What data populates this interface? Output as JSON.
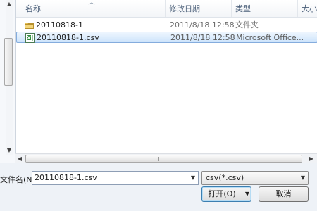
{
  "columns": {
    "name": "名称",
    "date": "修改日期",
    "type": "类型",
    "size": "大小"
  },
  "files": [
    {
      "name": "20110818-1",
      "date": "2011/8/18 12:58",
      "type": "文件夹",
      "icon": "folder-icon",
      "selected": false
    },
    {
      "name": "20110818-1.csv",
      "date": "2011/8/18 12:58",
      "type": "Microsoft Office...",
      "icon": "excel-csv-icon",
      "selected": true
    }
  ],
  "filename": {
    "label": "文件名(N):",
    "value": "20110818-1.csv"
  },
  "filetype": {
    "selected": "csv(*.csv)"
  },
  "buttons": {
    "open": "打开(O)",
    "cancel": "取消"
  },
  "colors": {
    "selection_border": "#84acdd",
    "selection_fill": "#cde4fb",
    "header_text": "#4c607a",
    "folder_yellow": "#e8c257",
    "excel_green": "#2e8b3b"
  }
}
